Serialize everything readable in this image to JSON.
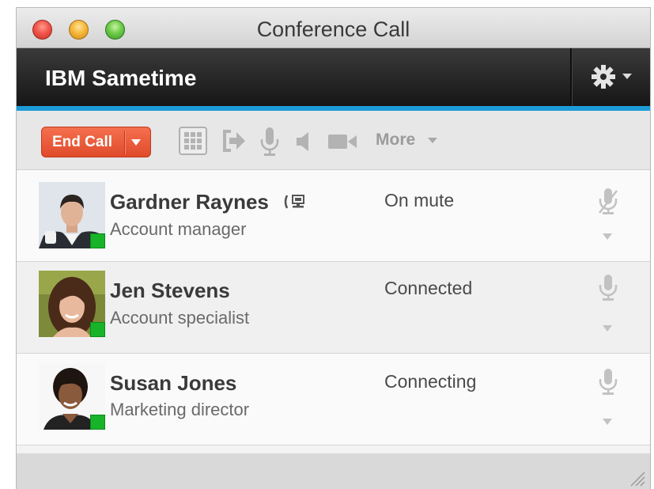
{
  "window": {
    "title": "Conference Call"
  },
  "app": {
    "name": "IBM Sametime"
  },
  "toolbar": {
    "end_call_label": "End Call",
    "more_label": "More"
  },
  "participants": [
    {
      "name": "Gardner Raynes",
      "role": "Account manager",
      "status": "On mute"
    },
    {
      "name": "Jen Stevens",
      "role": "Account specialist",
      "status": "Connected"
    },
    {
      "name": "Susan Jones",
      "role": "Marketing director",
      "status": "Connecting"
    }
  ],
  "colors": {
    "accent": "#1d9bd7",
    "end_call": "#e9593a",
    "presence_available": "#17b42a",
    "appbar": "#1f1f1f"
  },
  "icons": {
    "settings": "gear-icon",
    "keypad": "dialpad-icon",
    "transfer": "transfer-icon",
    "mic": "microphone-icon",
    "speaker": "speaker-icon",
    "video": "video-camera-icon",
    "muted": "microphone-muted-icon",
    "desk_phone": "desk-phone-icon"
  }
}
